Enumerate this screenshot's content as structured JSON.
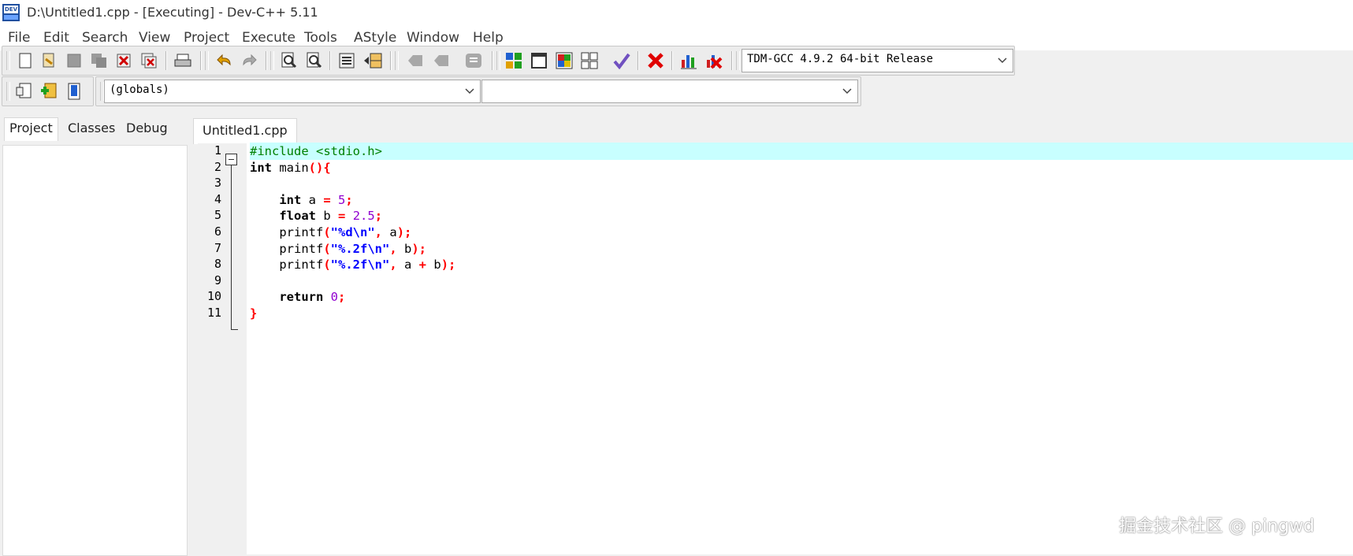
{
  "window": {
    "title": "D:\\Untitled1.cpp - [Executing] - Dev-C++ 5.11",
    "app_icon_label": "DEV"
  },
  "menu": [
    "File",
    "Edit",
    "Search",
    "View",
    "Project",
    "Execute",
    "Tools",
    "AStyle",
    "Window",
    "Help"
  ],
  "toolbar": {
    "compiler_select": "TDM-GCC 4.9.2 64-bit Release",
    "scope_select": "(globals)",
    "function_select": ""
  },
  "left_panel": {
    "tabs": [
      "Project",
      "Classes",
      "Debug"
    ]
  },
  "editor": {
    "tab_title": "Untitled1.cpp",
    "line_numbers": [
      "1",
      "2",
      "3",
      "4",
      "5",
      "6",
      "7",
      "8",
      "9",
      "10",
      "11"
    ],
    "lines": [
      [
        {
          "t": "#include <stdio.h>",
          "c": "pp"
        }
      ],
      [
        {
          "t": "int",
          "c": "kw"
        },
        {
          "t": " main",
          "c": "id"
        },
        {
          "t": "(){",
          "c": "sym"
        }
      ],
      [],
      [
        {
          "t": "    ",
          "c": "id"
        },
        {
          "t": "int",
          "c": "kw"
        },
        {
          "t": " a ",
          "c": "id"
        },
        {
          "t": "=",
          "c": "sym"
        },
        {
          "t": " ",
          "c": "id"
        },
        {
          "t": "5",
          "c": "num"
        },
        {
          "t": ";",
          "c": "sym"
        }
      ],
      [
        {
          "t": "    ",
          "c": "id"
        },
        {
          "t": "float",
          "c": "kw"
        },
        {
          "t": " b ",
          "c": "id"
        },
        {
          "t": "=",
          "c": "sym"
        },
        {
          "t": " ",
          "c": "id"
        },
        {
          "t": "2.5",
          "c": "num"
        },
        {
          "t": ";",
          "c": "sym"
        }
      ],
      [
        {
          "t": "    printf",
          "c": "id"
        },
        {
          "t": "(",
          "c": "sym"
        },
        {
          "t": "\"%d\\n\"",
          "c": "str"
        },
        {
          "t": ",",
          "c": "sym"
        },
        {
          "t": " a",
          "c": "id"
        },
        {
          "t": ");",
          "c": "sym"
        }
      ],
      [
        {
          "t": "    printf",
          "c": "id"
        },
        {
          "t": "(",
          "c": "sym"
        },
        {
          "t": "\"%.2f\\n\"",
          "c": "str"
        },
        {
          "t": ",",
          "c": "sym"
        },
        {
          "t": " b",
          "c": "id"
        },
        {
          "t": ");",
          "c": "sym"
        }
      ],
      [
        {
          "t": "    printf",
          "c": "id"
        },
        {
          "t": "(",
          "c": "sym"
        },
        {
          "t": "\"%.2f\\n\"",
          "c": "str"
        },
        {
          "t": ",",
          "c": "sym"
        },
        {
          "t": " a ",
          "c": "id"
        },
        {
          "t": "+",
          "c": "sym"
        },
        {
          "t": " b",
          "c": "id"
        },
        {
          "t": ");",
          "c": "sym"
        }
      ],
      [],
      [
        {
          "t": "    ",
          "c": "id"
        },
        {
          "t": "return",
          "c": "kw"
        },
        {
          "t": " ",
          "c": "id"
        },
        {
          "t": "0",
          "c": "num"
        },
        {
          "t": ";",
          "c": "sym"
        }
      ],
      [
        {
          "t": "}",
          "c": "sym"
        }
      ]
    ]
  },
  "watermark": "掘金技术社区 @ pingwd"
}
